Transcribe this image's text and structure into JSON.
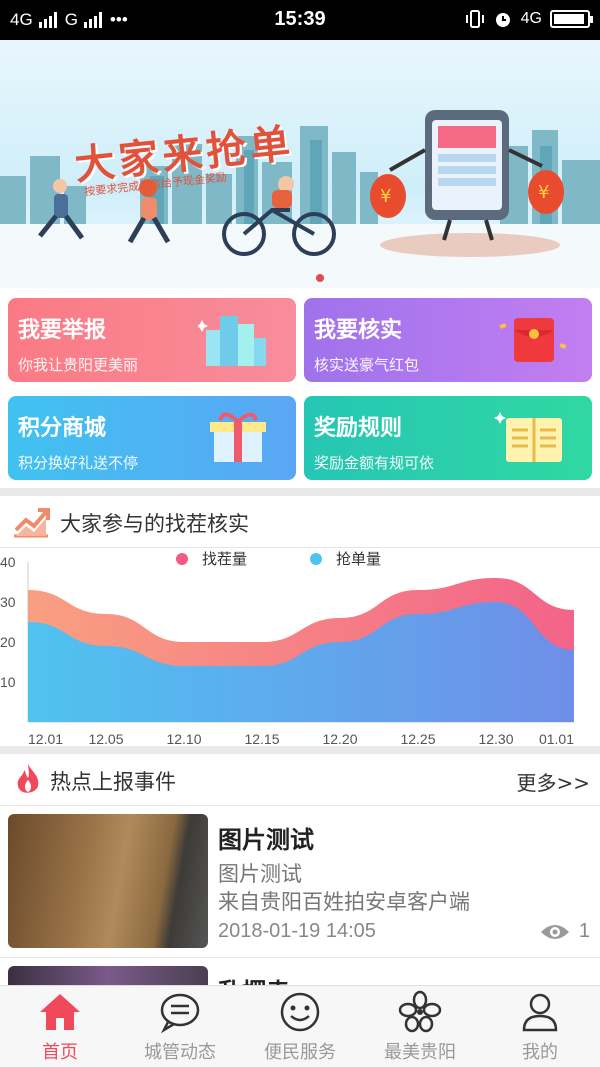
{
  "status_bar": {
    "network_left": "4G",
    "network_mid": "G",
    "dots": "•••",
    "time": "15:39",
    "network_right": "4G",
    "battery_level": 0.95
  },
  "banner": {
    "title": "大家来抢单",
    "subtitle": "按要求完成任务给予现金奖励",
    "active_index": 0,
    "slide_count": 1
  },
  "tiles": [
    {
      "title": "我要举报",
      "subtitle": "你我让贵阳更美丽",
      "icon": "buildings-icon"
    },
    {
      "title": "我要核实",
      "subtitle": "核实送豪气红包",
      "icon": "red-envelope-icon"
    },
    {
      "title": "积分商城",
      "subtitle": "积分换好礼送不停",
      "icon": "gift-box-icon"
    },
    {
      "title": "奖励规则",
      "subtitle": "奖励金额有规可依",
      "icon": "open-book-icon"
    }
  ],
  "participation": {
    "title": "大家参与的找茬核实",
    "icon": "trend-chart-icon"
  },
  "chart_data": {
    "type": "area",
    "x": [
      "12.01",
      "12.05",
      "12.10",
      "12.15",
      "12.20",
      "12.25",
      "12.30",
      "01.01"
    ],
    "ylim": [
      0,
      40
    ],
    "yticks": [
      10,
      20,
      30,
      40
    ],
    "series": [
      {
        "name": "找茬量",
        "color": "#f25b83",
        "values": [
          33,
          27,
          20,
          20,
          26,
          33,
          36,
          28
        ]
      },
      {
        "name": "抢单量",
        "color": "#4fc3f0",
        "values": [
          25,
          19,
          14,
          14,
          20,
          27,
          30,
          18
        ]
      }
    ]
  },
  "hot": {
    "title": "热点上报事件",
    "more": "更多>>",
    "icon": "flame-icon"
  },
  "news": [
    {
      "title": "图片测试",
      "desc": "图片测试",
      "source": "来自贵阳百姓拍安卓客户端",
      "date": "2018-01-19 14:05",
      "views": "1"
    },
    {
      "title": "乱摆卖"
    }
  ],
  "tabbar": [
    {
      "label": "首页",
      "icon": "home-icon",
      "active": true
    },
    {
      "label": "城管动态",
      "icon": "message-bubble-icon",
      "active": false
    },
    {
      "label": "便民服务",
      "icon": "smiley-icon",
      "active": false
    },
    {
      "label": "最美贵阳",
      "icon": "flower-icon",
      "active": false
    },
    {
      "label": "我的",
      "icon": "user-icon",
      "active": false
    }
  ],
  "colors": {
    "accent": "#f0495a",
    "tile_report": "#fa7a84",
    "tile_verify": "#b07aef",
    "tile_mall": "#4ab6f2",
    "tile_rules": "#2bcdab"
  }
}
